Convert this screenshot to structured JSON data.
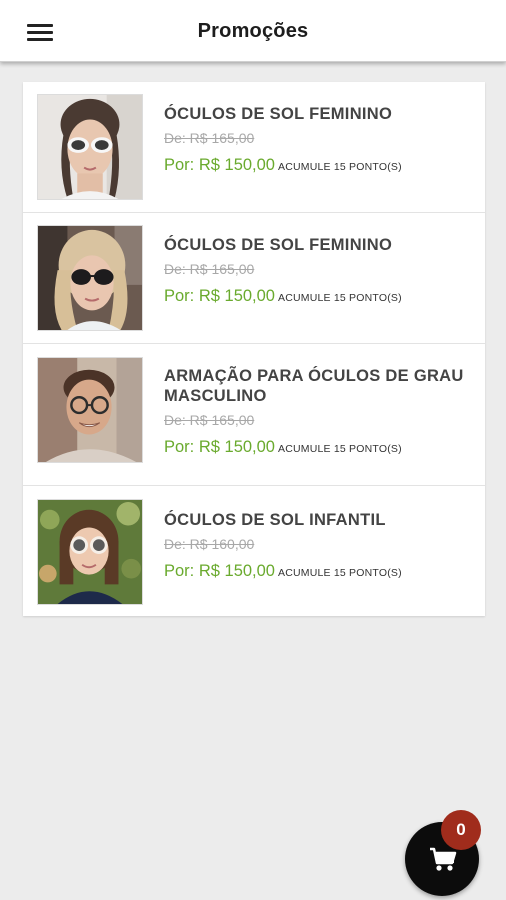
{
  "header": {
    "title": "Promoções",
    "menu_icon": "menu-icon"
  },
  "products": [
    {
      "name": "ÓCULOS DE SOL FEMININO",
      "old_price": "De: R$ 165,00",
      "new_price": "Por: R$ 150,00",
      "points": "ACUMULE 15 PONTO(S)",
      "image": "woman-white-sunglasses-photo"
    },
    {
      "name": "ÓCULOS DE SOL FEMININO",
      "old_price": "De: R$ 165,00",
      "new_price": "Por: R$ 150,00",
      "points": "ACUMULE 15 PONTO(S)",
      "image": "woman-dark-sunglasses-photo"
    },
    {
      "name": "ARMAÇÃO PARA ÓCULOS DE GRAU MASCULINO",
      "old_price": "De: R$ 165,00",
      "new_price": "Por: R$ 150,00",
      "points": "ACUMULE 15 PONTO(S)",
      "image": "man-eyeglasses-photo"
    },
    {
      "name": "ÓCULOS DE SOL INFANTIL",
      "old_price": "De: R$ 160,00",
      "new_price": "Por: R$ 150,00",
      "points": "ACUMULE 15 PONTO(S)",
      "image": "child-sunglasses-photo"
    }
  ],
  "cart": {
    "count": "0",
    "icon": "shopping-cart-icon"
  },
  "colors": {
    "new_price": "#6aaa2e",
    "old_price": "#a8a8a8",
    "badge": "#a02c1c",
    "fab": "#0c0c0c"
  }
}
